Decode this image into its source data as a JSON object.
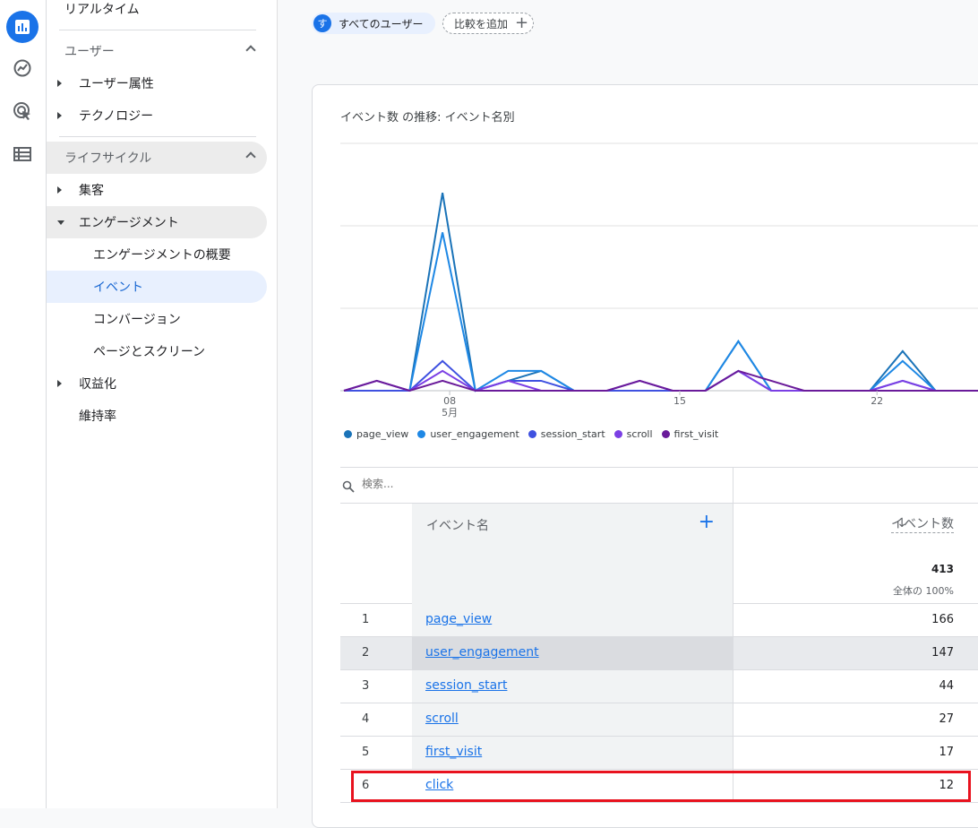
{
  "rail": {
    "icons": [
      "bar-chart-icon",
      "insights-icon",
      "target-cursor-icon",
      "list-icon"
    ]
  },
  "sidenav": {
    "realtime": "リアルタイム",
    "user_section": "ユーザー",
    "user_attributes": "ユーザー属性",
    "technology": "テクノロジー",
    "lifecycle_section": "ライフサイクル",
    "acquisition": "集客",
    "engagement": "エンゲージメント",
    "engagement_overview": "エンゲージメントの概要",
    "events": "イベント",
    "conversions": "コンバージョン",
    "pages_screens": "ページとスクリーン",
    "monetization": "収益化",
    "retention": "維持率"
  },
  "chips": {
    "avatar_letter": "す",
    "all_users": "すべてのユーザー",
    "add_comparison": "比較を追加"
  },
  "card": {
    "title": "イベント数 の推移: イベント名別"
  },
  "chart_data": {
    "type": "line",
    "x_ticks": [
      "08",
      "15",
      "22"
    ],
    "x_month_label": "5月",
    "x": [
      1,
      2,
      3,
      4,
      5,
      6,
      7,
      8,
      9,
      10,
      11,
      12,
      13,
      14,
      15,
      16,
      17,
      18,
      19,
      20,
      21,
      22,
      23,
      24,
      25,
      26,
      27,
      28,
      29
    ],
    "grid": true,
    "series": [
      {
        "name": "page_view",
        "color": "#1a73b8",
        "values": [
          0,
          0,
          0,
          20,
          0,
          1,
          2,
          0,
          0,
          0,
          0,
          0,
          5,
          0,
          0,
          0,
          0,
          4,
          0,
          0,
          0,
          0,
          9,
          3,
          1,
          0,
          1,
          0,
          0
        ]
      },
      {
        "name": "user_engagement",
        "color": "#1e88e5",
        "values": [
          0,
          0,
          0,
          16,
          0,
          2,
          2,
          0,
          0,
          0,
          0,
          0,
          5,
          0,
          0,
          0,
          0,
          3,
          0,
          0,
          0,
          0,
          8,
          4,
          1,
          0,
          1,
          0,
          0
        ]
      },
      {
        "name": "session_start",
        "color": "#3f51e0",
        "values": [
          0,
          0,
          0,
          3,
          0,
          1,
          1,
          0,
          0,
          0,
          0,
          0,
          2,
          0,
          0,
          0,
          0,
          1,
          0,
          0,
          0,
          0,
          3,
          5,
          1,
          0,
          1,
          0,
          0
        ]
      },
      {
        "name": "scroll",
        "color": "#7b3fe4",
        "values": [
          0,
          1,
          0,
          2,
          0,
          1,
          0,
          0,
          0,
          1,
          0,
          0,
          2,
          0,
          0,
          0,
          0,
          1,
          0,
          0,
          0,
          0,
          2,
          3,
          0,
          0,
          1,
          0,
          0
        ]
      },
      {
        "name": "first_visit",
        "color": "#6a1b9a",
        "values": [
          0,
          1,
          0,
          1,
          0,
          0,
          0,
          0,
          0,
          1,
          0,
          0,
          2,
          1,
          0,
          0,
          0,
          0,
          0,
          0,
          0,
          0,
          0,
          3,
          0,
          0,
          1,
          0,
          0
        ]
      }
    ]
  },
  "table": {
    "search_placeholder": "検索...",
    "col_event_name": "イベント名",
    "col_event_count": "イベント数",
    "total": "413",
    "total_pct": "全体の 100%",
    "rows": [
      {
        "idx": "1",
        "name": "page_view",
        "value": "166"
      },
      {
        "idx": "2",
        "name": "user_engagement",
        "value": "147"
      },
      {
        "idx": "3",
        "name": "session_start",
        "value": "44"
      },
      {
        "idx": "4",
        "name": "scroll",
        "value": "27"
      },
      {
        "idx": "5",
        "name": "first_visit",
        "value": "17"
      },
      {
        "idx": "6",
        "name": "click",
        "value": "12"
      }
    ]
  }
}
